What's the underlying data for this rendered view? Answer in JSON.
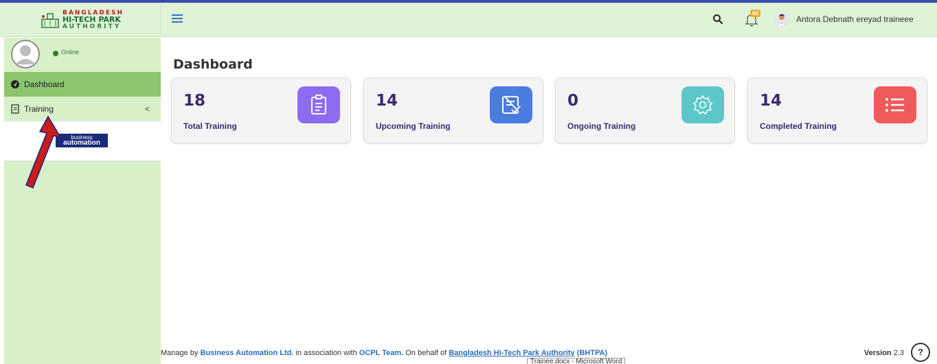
{
  "header": {
    "logo": {
      "line1": "BANGLADESH",
      "line2": "HI-TECH PARK",
      "line3": "AUTHORITY"
    },
    "notification_count": "68",
    "user_name": "Antora Debnath ereyad traineee"
  },
  "sidebar": {
    "status": "Online",
    "items": [
      {
        "label": "Dashboard",
        "icon": "dashboard-gauge-icon",
        "active": true
      },
      {
        "label": "Training",
        "icon": "document-icon",
        "chevron": "<"
      }
    ],
    "partner_logo": {
      "line1": "business",
      "line2": "automation"
    }
  },
  "main": {
    "title": "Dashboard",
    "cards": [
      {
        "value": "18",
        "label": "Total Training",
        "icon": "clipboard-icon",
        "color": "#8e6cf2"
      },
      {
        "value": "14",
        "label": "Upcoming Training",
        "icon": "checklist-icon",
        "color": "#4a7ce0"
      },
      {
        "value": "0",
        "label": "Ongoing Training",
        "icon": "gear-icon",
        "color": "#5cc7c9"
      },
      {
        "value": "14",
        "label": "Completed Training",
        "icon": "list-icon",
        "color": "#ef5a5a"
      }
    ]
  },
  "footer": {
    "prefix": "Manage by",
    "company": "Business Automation Ltd.",
    "mid": "in association with",
    "team": "OCPL Team.",
    "behalf": "On behalf of",
    "authority": "Bangladesh Hi-Tech Park Authority",
    "abbr": "(BHTPA)",
    "version_label": "Version",
    "version_number": "2.3",
    "help": "?"
  },
  "tooltip": "Trainee.docx - Microsoft Word",
  "colors": {
    "accent_bar": "#3949ab",
    "header_bg": "#dff3d6",
    "sidebar_bg": "#d8f0c8",
    "active_item": "#8bc66e"
  }
}
